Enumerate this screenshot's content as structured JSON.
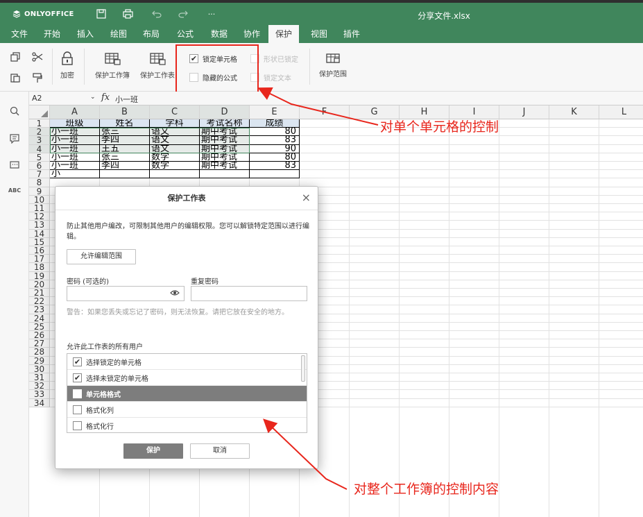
{
  "app": {
    "logo_text": "ONLYOFFICE",
    "doc_title": "分享文件.xlsx",
    "quick_access": [
      "save-icon",
      "print-icon",
      "undo-icon",
      "redo-icon",
      "more-icon"
    ],
    "more_label": "···"
  },
  "menu": {
    "tabs": [
      "文件",
      "开始",
      "插入",
      "绘图",
      "布局",
      "公式",
      "数据",
      "协作",
      "保护",
      "视图",
      "插件"
    ],
    "active": "保护"
  },
  "toolbar": {
    "encrypt_label": "加密",
    "protect_workbook_label": "保护工作簿",
    "protect_sheet_label": "保护工作表",
    "locked_cell_label": "锁定单元格",
    "locked_cell_checked": true,
    "shape_locked_label": "形状已锁定",
    "hidden_formula_label": "隐藏的公式",
    "hidden_formula_checked": false,
    "lock_text_label": "锁定文本",
    "protect_range_label": "保护范围"
  },
  "formula_bar": {
    "name_box": "A2",
    "fx": "fx",
    "value": "小一班"
  },
  "sheet": {
    "columns": [
      "A",
      "B",
      "C",
      "D",
      "E",
      "F",
      "G",
      "H",
      "I",
      "J",
      "K",
      "L"
    ],
    "rows": [
      "1",
      "2",
      "3",
      "4",
      "5",
      "6",
      "7",
      "8",
      "9",
      "10",
      "11",
      "12",
      "13",
      "14",
      "15",
      "16",
      "17",
      "18",
      "19",
      "20",
      "21",
      "22",
      "23",
      "24",
      "25",
      "26",
      "27",
      "28",
      "29",
      "30",
      "31",
      "32",
      "33",
      "34"
    ],
    "header": [
      "班级",
      "姓名",
      "学科",
      "考试名称",
      "成绩"
    ],
    "data": [
      [
        "小一班",
        "张三",
        "语文",
        "期中考试",
        "80"
      ],
      [
        "小一班",
        "李四",
        "语文",
        "期中考试",
        "83"
      ],
      [
        "小一班",
        "王五",
        "语文",
        "期中考试",
        "90"
      ],
      [
        "小一班",
        "张三",
        "数学",
        "期中考试",
        "80"
      ],
      [
        "小一班",
        "李四",
        "数学",
        "期中考试",
        "83"
      ],
      [
        "小",
        "",
        "",
        "",
        ""
      ]
    ]
  },
  "dialog": {
    "title": "保护工作表",
    "close": "×",
    "description": "防止其他用户编改，可限制其他用户的编辑权限。您可以解锁特定范围以进行编辑。",
    "allow_ranges_button": "允许编辑范围",
    "password_label": "密码 (可选的)",
    "password_value": "",
    "repeat_password_label": "重复密码",
    "repeat_password_value": "",
    "warning": "警告：如果您丢失或忘记了密码，则无法恢复。请把它放在安全的地方。",
    "permissions_label": "允许此工作表的所有用户",
    "permissions": [
      {
        "label": "选择锁定的单元格",
        "checked": true
      },
      {
        "label": "选择未锁定的单元格",
        "checked": true
      },
      {
        "label": "单元格格式",
        "checked": false,
        "selected": true
      },
      {
        "label": "格式化列",
        "checked": false
      },
      {
        "label": "格式化行",
        "checked": false
      }
    ],
    "protect_button": "保护",
    "cancel_button": "取消"
  },
  "annotations": {
    "cell_control": "对单个单元格的控制",
    "workbook_control": "对整个工作簿的控制内容",
    "color": "#e8261c"
  },
  "colors": {
    "brand": "#40865c",
    "accent_red": "#e8261c",
    "selected_item": "#7d7d7d"
  }
}
